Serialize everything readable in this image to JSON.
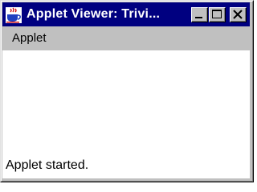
{
  "window": {
    "title": "Applet Viewer: Trivi...",
    "icon": "java-coffee-cup-icon",
    "controls": {
      "minimize": "minimize-icon",
      "maximize": "maximize-icon",
      "close": "close-icon"
    },
    "title_bar_color": "#000080"
  },
  "menu": {
    "items": [
      {
        "label": "Applet"
      }
    ]
  },
  "status": {
    "text": "Applet started."
  }
}
